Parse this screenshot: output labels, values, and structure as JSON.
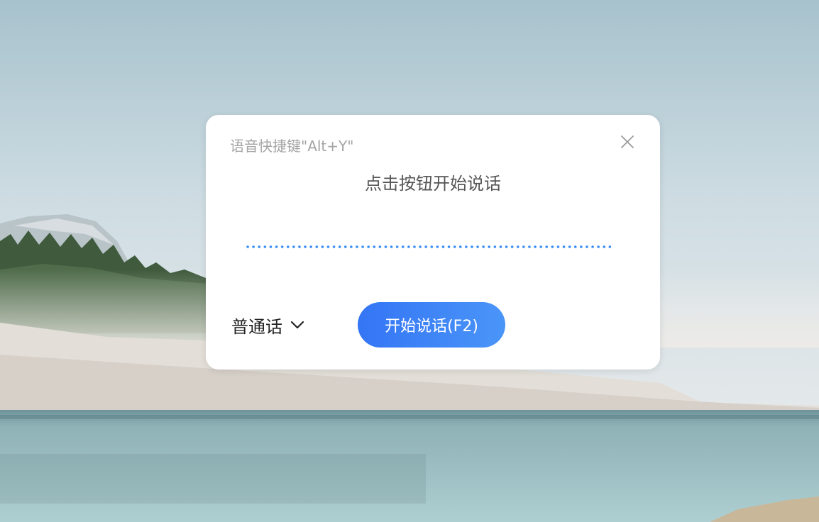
{
  "dialog": {
    "shortcut_hint": "语音快捷键\"Alt+Y\"",
    "prompt": "点击按钮开始说话",
    "language": "普通话",
    "start_button": "开始说话(F2)"
  },
  "icons": {
    "close": "close-icon",
    "chevron": "chevron-down-icon"
  },
  "colors": {
    "button_start": "#3475f5",
    "button_end": "#4a95f8",
    "wave_dots": "#3a8ef5"
  }
}
